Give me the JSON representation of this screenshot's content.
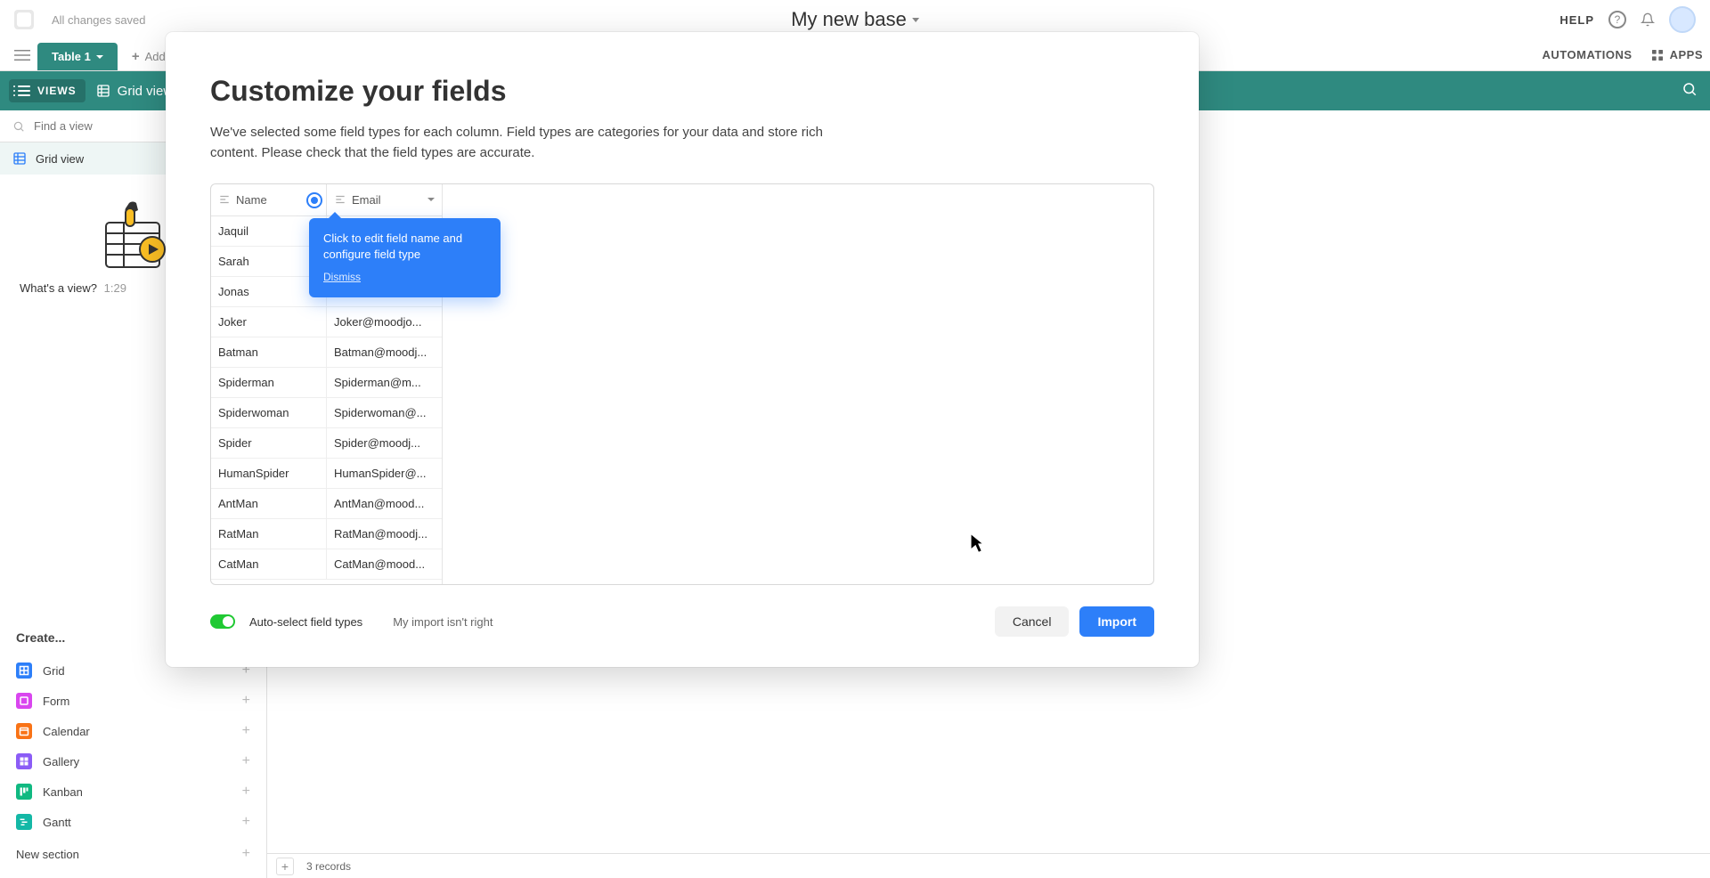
{
  "topbar": {
    "save_status": "All changes saved",
    "base_name": "My new base",
    "help": "HELP"
  },
  "tabbar": {
    "table": "Table 1",
    "add_label": "Add or import",
    "automations": "AUTOMATIONS",
    "apps": "APPS"
  },
  "viewbar": {
    "views": "VIEWS",
    "grid_view": "Grid view"
  },
  "sidebar": {
    "search_placeholder": "Find a view",
    "active_view": "Grid view",
    "caption_q": "What's a view?",
    "caption_time": "1:29",
    "create": "Create...",
    "views": {
      "grid": "Grid",
      "form": "Form",
      "calendar": "Calendar",
      "gallery": "Gallery",
      "kanban": "Kanban",
      "gantt": "Gantt"
    },
    "new_section": "New section"
  },
  "footer": {
    "records": "3 records"
  },
  "modal": {
    "title": "Customize your fields",
    "desc": "We've selected some field types for each column. Field types are categories for your data and store rich content. Please check that the field types are accurate.",
    "col1": "Name",
    "col2": "Email",
    "rows": [
      {
        "name": "Jaquil",
        "email": ""
      },
      {
        "name": "Sarah",
        "email": ""
      },
      {
        "name": "Jonas",
        "email": ""
      },
      {
        "name": "Joker",
        "email": "Joker@moodjo..."
      },
      {
        "name": "Batman",
        "email": "Batman@moodj..."
      },
      {
        "name": "Spiderman",
        "email": "Spiderman@m..."
      },
      {
        "name": "Spiderwoman",
        "email": "Spiderwoman@..."
      },
      {
        "name": "Spider",
        "email": "Spider@moodj..."
      },
      {
        "name": "HumanSpider",
        "email": "HumanSpider@..."
      },
      {
        "name": "AntMan",
        "email": "AntMan@mood..."
      },
      {
        "name": "RatMan",
        "email": "RatMan@moodj..."
      },
      {
        "name": "CatMan",
        "email": "CatMan@mood..."
      }
    ],
    "tooltip": {
      "msg": "Click to edit field name and configure field type",
      "dismiss": "Dismiss"
    },
    "auto": "Auto-select field types",
    "wrong": "My import isn't right",
    "cancel": "Cancel",
    "import": "Import"
  }
}
